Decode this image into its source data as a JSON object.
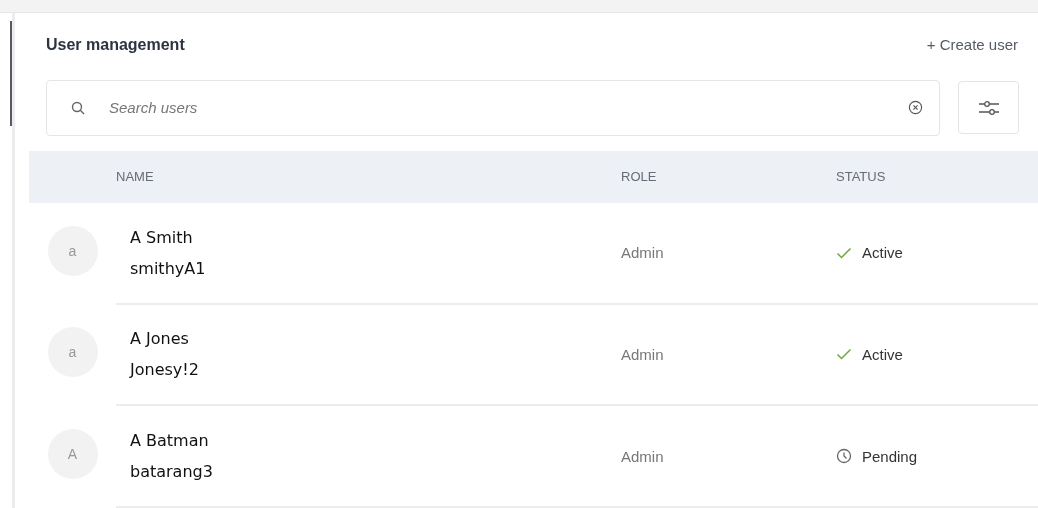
{
  "title": "User management",
  "create_button": {
    "icon": "+",
    "label": "Create user"
  },
  "search": {
    "placeholder": "Search users"
  },
  "table": {
    "columns": [
      "NAME",
      "ROLE",
      "STATUS"
    ],
    "rows": [
      {
        "avatar": "a",
        "name": "A Smith",
        "username": "smithyA1",
        "role": "Admin",
        "status": {
          "kind": "active",
          "label": "Active"
        }
      },
      {
        "avatar": "a",
        "name": "A Jones",
        "username": "Jonesy!2",
        "role": "Admin",
        "status": {
          "kind": "active",
          "label": "Active"
        }
      },
      {
        "avatar": "A",
        "name": "A Batman",
        "username": "batarang3",
        "role": "Admin",
        "status": {
          "kind": "pending",
          "label": "Pending"
        }
      }
    ]
  }
}
